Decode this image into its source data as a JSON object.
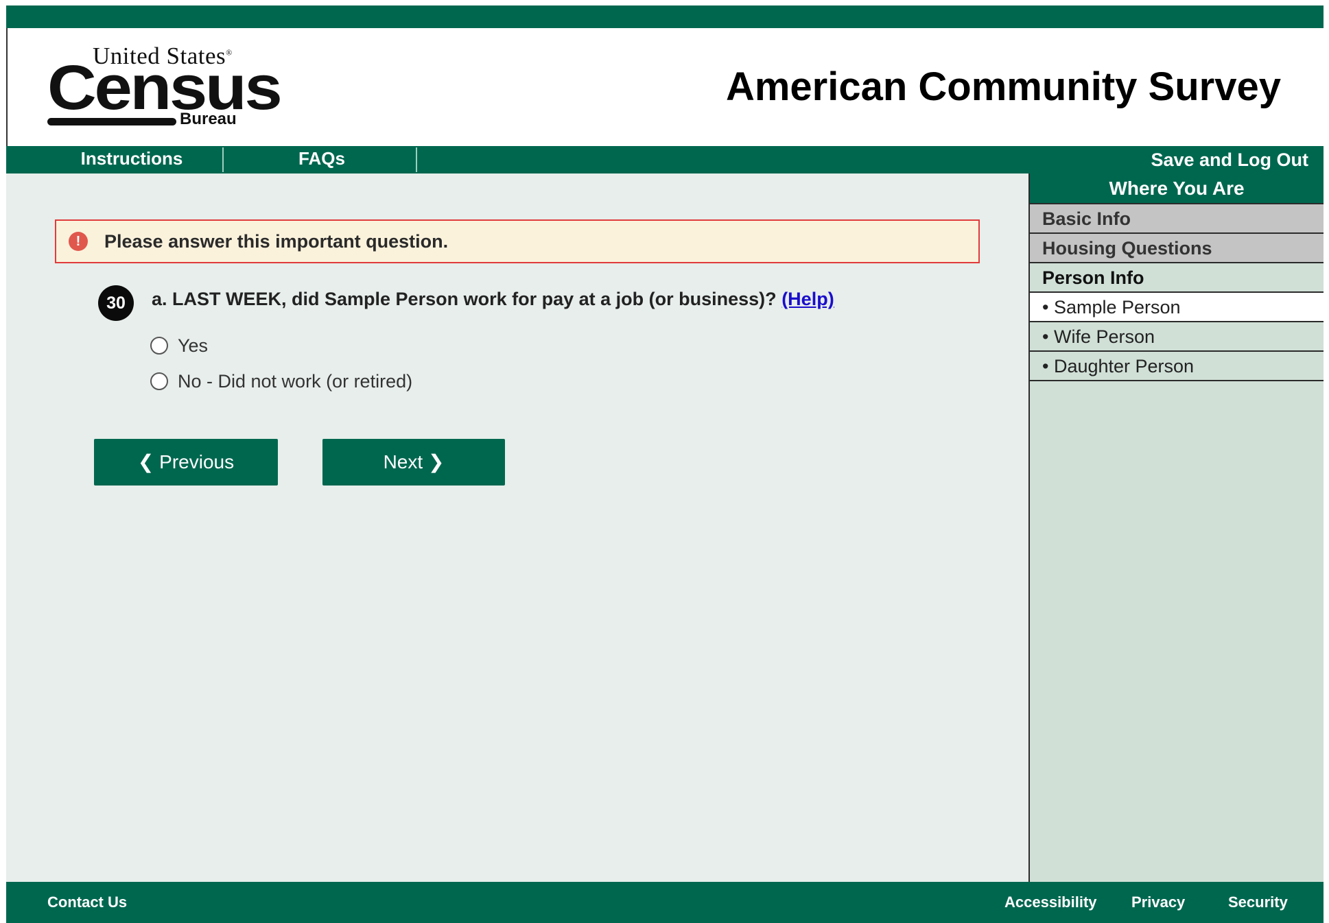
{
  "header": {
    "logo": {
      "line1": "United States",
      "reg": "®",
      "line2": "Census",
      "line3": "Bureau"
    },
    "title": "American Community Survey"
  },
  "nav": {
    "instructions": "Instructions",
    "faqs": "FAQs",
    "save_logout": "Save and Log Out"
  },
  "alert": {
    "icon": "!",
    "message": "Please answer this important question."
  },
  "question": {
    "number": "30",
    "text": "a. LAST WEEK, did Sample Person work for pay at a job (or business)?",
    "help_link": "(Help)",
    "options": [
      {
        "label": "Yes"
      },
      {
        "label": "No - Did not work (or retired)"
      }
    ]
  },
  "buttons": {
    "previous": "Previous",
    "previous_icon": "❮",
    "next": "Next",
    "next_icon": "❯"
  },
  "sidebar": {
    "heading": "Where You Are",
    "sections": [
      {
        "label": "Basic Info"
      },
      {
        "label": "Housing Questions"
      }
    ],
    "active_section": "Person Info",
    "people": [
      {
        "label": "• Sample Person"
      },
      {
        "label": "• Wife Person"
      },
      {
        "label": "• Daughter Person"
      }
    ]
  },
  "footer": {
    "contact": "Contact Us",
    "accessibility": "Accessibility",
    "privacy": "Privacy",
    "security": "Security"
  },
  "colors": {
    "brand_green": "#00674f",
    "content_bg": "#e7eeeb",
    "sidebar_bg": "#d0e0d7",
    "alert_border": "#e03b3b",
    "alert_bg": "#fbf2dc",
    "link": "#1a0dcc"
  }
}
